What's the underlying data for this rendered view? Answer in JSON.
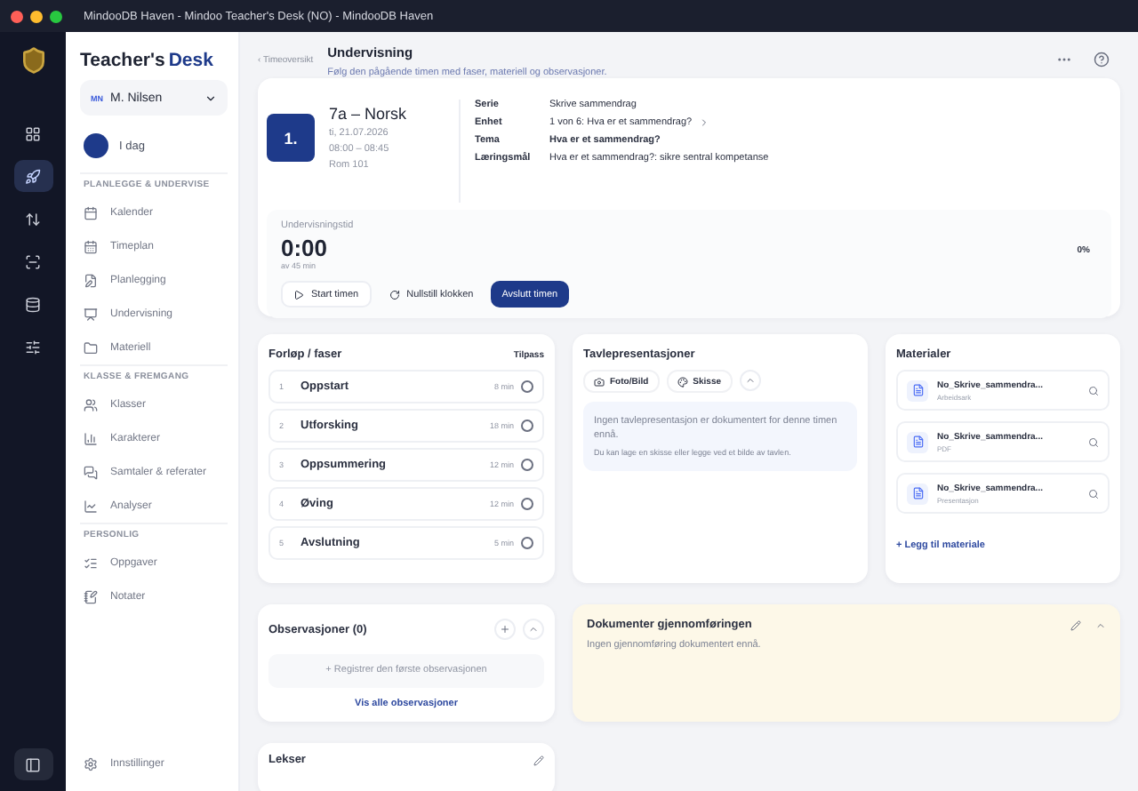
{
  "window": {
    "title": "MindooDB Haven - Mindoo Teacher's Desk (NO) - MindooDB Haven"
  },
  "rail": [
    {
      "selected": false
    },
    {
      "selected": true
    },
    {
      "selected": false
    },
    {
      "selected": false
    },
    {
      "selected": false
    },
    {
      "selected": false
    }
  ],
  "brand": {
    "first": "Teacher's",
    "second": "Desk"
  },
  "user": {
    "initials": "MN",
    "name": "M. Nilsen"
  },
  "today": {
    "label": "I dag"
  },
  "sections": [
    {
      "title": "PLANLEGGE & UNDERVISE",
      "items": [
        {
          "label": "Kalender"
        },
        {
          "label": "Timeplan"
        },
        {
          "label": "Planlegging"
        },
        {
          "label": "Undervisning"
        },
        {
          "label": "Materiell"
        }
      ]
    },
    {
      "title": "KLASSE & FREMGANG",
      "items": [
        {
          "label": "Klasser"
        },
        {
          "label": "Karakterer"
        },
        {
          "label": "Samtaler & referater"
        },
        {
          "label": "Analyser"
        }
      ]
    },
    {
      "title": "PERSONLIG",
      "items": [
        {
          "label": "Oppgaver"
        },
        {
          "label": "Notater"
        }
      ]
    }
  ],
  "settings": {
    "label": "Innstillinger"
  },
  "header": {
    "back": "‹ Timeoversikt",
    "title": "Undervisning",
    "subtitle": "Følg den pågående timen med faser, materiell og observasjoner."
  },
  "lesson": {
    "number": "1.",
    "title": "7a – Norsk",
    "date": "ti, 21.07.2026",
    "time": "08:00 – 08:45",
    "room": "Rom 101",
    "details": [
      {
        "key": "Serie",
        "value": "Skrive sammendrag",
        "bold": false,
        "link": false
      },
      {
        "key": "Enhet",
        "value": "1 von 6: Hva er et sammendrag?",
        "bold": false,
        "link": true
      },
      {
        "key": "Tema",
        "value": "Hva er et sammendrag?",
        "bold": true,
        "link": false
      },
      {
        "key": "Læringsmål",
        "value": "Hva er et sammendrag?: sikre sentral kompetanse",
        "bold": false,
        "link": false
      }
    ]
  },
  "timer": {
    "label": "Undervisningstid",
    "time": "0:00",
    "of": "av 45 min",
    "percent": "0%",
    "buttons": [
      {
        "kind": "start",
        "label": "Start timen"
      },
      {
        "kind": "reset",
        "label": "Nullstill klokken"
      },
      {
        "kind": "primary",
        "label": "Avslutt timen"
      }
    ]
  },
  "phases": {
    "title": "Forløp / faser",
    "action": "Tilpass",
    "items": [
      {
        "number": "1",
        "name": "Oppstart",
        "duration": "8 min",
        "done": false
      },
      {
        "number": "2",
        "name": "Utforsking",
        "duration": "18 min",
        "done": false
      },
      {
        "number": "3",
        "name": "Oppsummering",
        "duration": "12 min",
        "done": false
      },
      {
        "number": "4",
        "name": "Øving",
        "duration": "12 min",
        "done": false
      },
      {
        "number": "5",
        "name": "Avslutning",
        "duration": "5 min",
        "done": false
      }
    ]
  },
  "board": {
    "title": "Tavlepresentasjoner",
    "buttons": [
      {
        "kind": "photo",
        "label": "Foto/Bild"
      },
      {
        "kind": "sketch",
        "label": "Skisse"
      }
    ],
    "empty": "Ingen tavlepresentasjon er dokumentert for denne timen ennå.",
    "hint": "Du kan lage en skisse eller legge ved et bilde av tavlen."
  },
  "materials": {
    "title": "Materialer",
    "items": [
      {
        "name": "No_Skrive_sammendra...",
        "type": "Arbeidsark"
      },
      {
        "name": "No_Skrive_sammendra...",
        "type": "PDF"
      },
      {
        "name": "No_Skrive_sammendra...",
        "type": "Presentasjon"
      }
    ],
    "add": "+ Legg til materiale"
  },
  "observations": {
    "title": "Observasjoner (0)",
    "register": "+ Registrer den første observasjonen",
    "all": "Vis alle observasjoner"
  },
  "documentation": {
    "title": "Dokumenter gjennomføringen",
    "empty": "Ingen gjennomføring dokumentert ennå."
  },
  "homework": {
    "title": "Lekser"
  }
}
